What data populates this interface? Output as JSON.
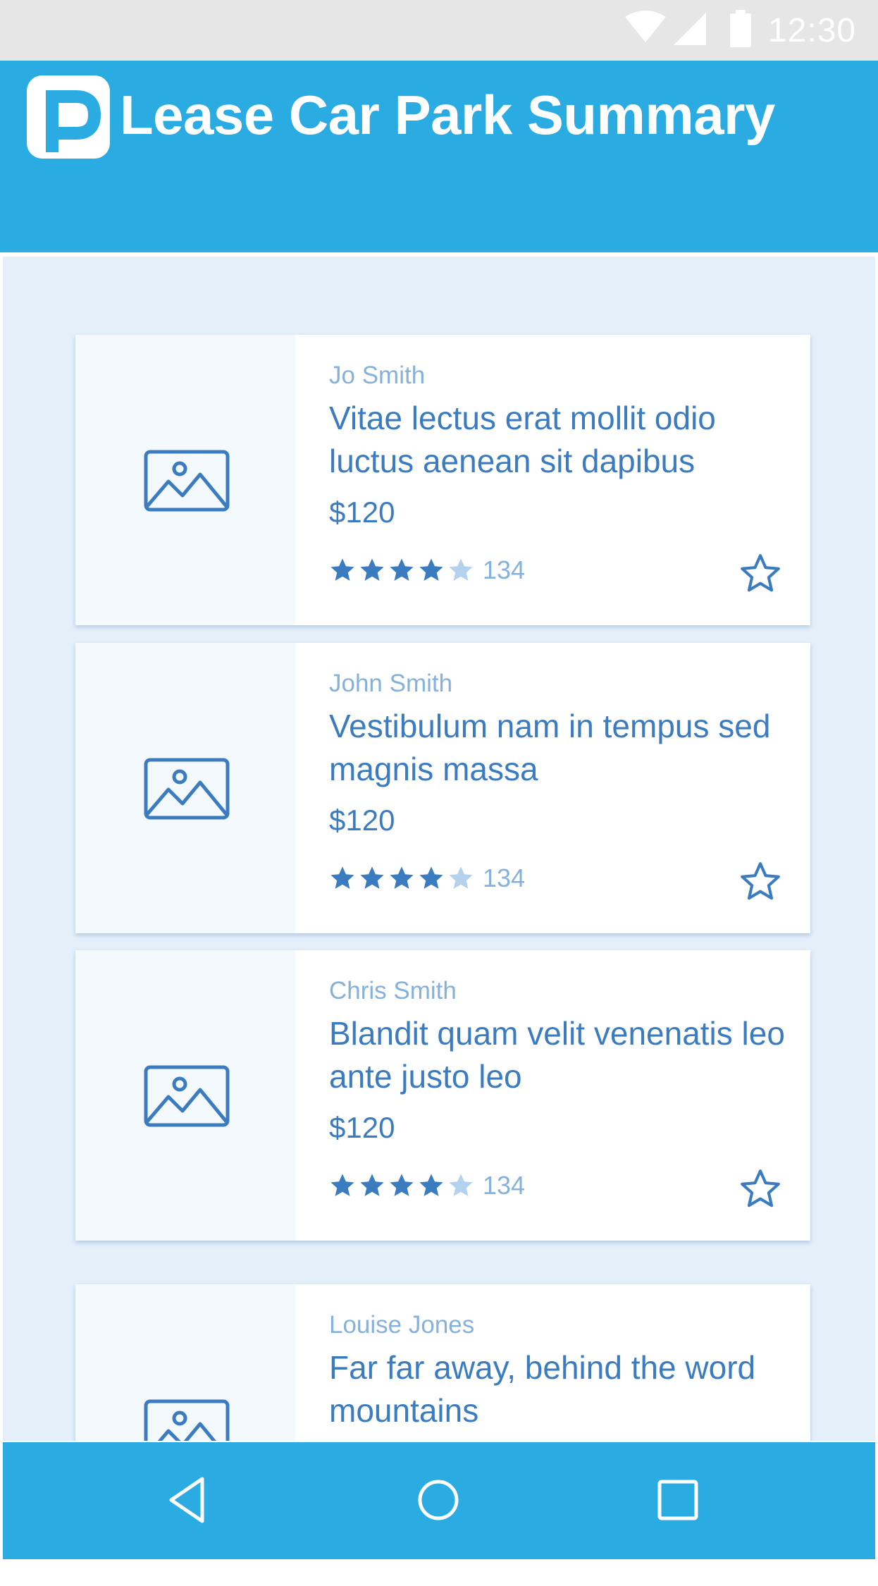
{
  "status_bar": {
    "time": "12:30",
    "icons": [
      "wifi-icon",
      "signal-icon",
      "battery-icon"
    ]
  },
  "app_bar": {
    "title": "Lease Car Park Summary",
    "logo_icon": "parking-logo-icon",
    "color": "#2aabe1"
  },
  "listings": [
    {
      "author": "Jo Smith",
      "title": "Vitae lectus erat mollit odio luctus aenean sit dapibus",
      "price": "$120",
      "rating": 4.5,
      "rating_count": "134",
      "image_icon": "image-placeholder-icon"
    },
    {
      "author": "John Smith",
      "title": "Vestibulum nam in tempus sed magnis massa",
      "price": "$120",
      "rating": 4.5,
      "rating_count": "134",
      "image_icon": "image-placeholder-icon"
    },
    {
      "author": "Chris Smith",
      "title": "Blandit quam velit venenatis leo ante justo leo",
      "price": "$120",
      "rating": 4.5,
      "rating_count": "134",
      "image_icon": "image-placeholder-icon"
    },
    {
      "author": "Louise Jones",
      "title": "Far far away, behind the word mountains",
      "image_icon": "image-placeholder-icon"
    }
  ],
  "nav_bar": {
    "buttons": [
      "back-icon",
      "home-icon",
      "recents-icon"
    ]
  },
  "colors": {
    "primary": "#2aabe1",
    "text_blue": "#3b7cc0",
    "text_muted": "#86b1da",
    "background": "#e4effa"
  }
}
